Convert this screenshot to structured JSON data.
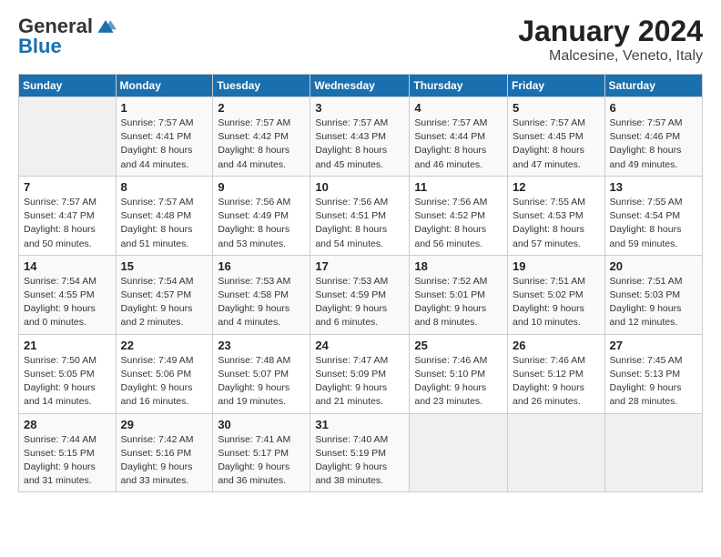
{
  "logo": {
    "general": "General",
    "blue": "Blue"
  },
  "title": {
    "month": "January 2024",
    "location": "Malcesine, Veneto, Italy"
  },
  "weekdays": [
    "Sunday",
    "Monday",
    "Tuesday",
    "Wednesday",
    "Thursday",
    "Friday",
    "Saturday"
  ],
  "weeks": [
    [
      {
        "day": "",
        "info": ""
      },
      {
        "day": "1",
        "info": "Sunrise: 7:57 AM\nSunset: 4:41 PM\nDaylight: 8 hours\nand 44 minutes."
      },
      {
        "day": "2",
        "info": "Sunrise: 7:57 AM\nSunset: 4:42 PM\nDaylight: 8 hours\nand 44 minutes."
      },
      {
        "day": "3",
        "info": "Sunrise: 7:57 AM\nSunset: 4:43 PM\nDaylight: 8 hours\nand 45 minutes."
      },
      {
        "day": "4",
        "info": "Sunrise: 7:57 AM\nSunset: 4:44 PM\nDaylight: 8 hours\nand 46 minutes."
      },
      {
        "day": "5",
        "info": "Sunrise: 7:57 AM\nSunset: 4:45 PM\nDaylight: 8 hours\nand 47 minutes."
      },
      {
        "day": "6",
        "info": "Sunrise: 7:57 AM\nSunset: 4:46 PM\nDaylight: 8 hours\nand 49 minutes."
      }
    ],
    [
      {
        "day": "7",
        "info": "Sunrise: 7:57 AM\nSunset: 4:47 PM\nDaylight: 8 hours\nand 50 minutes."
      },
      {
        "day": "8",
        "info": "Sunrise: 7:57 AM\nSunset: 4:48 PM\nDaylight: 8 hours\nand 51 minutes."
      },
      {
        "day": "9",
        "info": "Sunrise: 7:56 AM\nSunset: 4:49 PM\nDaylight: 8 hours\nand 53 minutes."
      },
      {
        "day": "10",
        "info": "Sunrise: 7:56 AM\nSunset: 4:51 PM\nDaylight: 8 hours\nand 54 minutes."
      },
      {
        "day": "11",
        "info": "Sunrise: 7:56 AM\nSunset: 4:52 PM\nDaylight: 8 hours\nand 56 minutes."
      },
      {
        "day": "12",
        "info": "Sunrise: 7:55 AM\nSunset: 4:53 PM\nDaylight: 8 hours\nand 57 minutes."
      },
      {
        "day": "13",
        "info": "Sunrise: 7:55 AM\nSunset: 4:54 PM\nDaylight: 8 hours\nand 59 minutes."
      }
    ],
    [
      {
        "day": "14",
        "info": "Sunrise: 7:54 AM\nSunset: 4:55 PM\nDaylight: 9 hours\nand 0 minutes."
      },
      {
        "day": "15",
        "info": "Sunrise: 7:54 AM\nSunset: 4:57 PM\nDaylight: 9 hours\nand 2 minutes."
      },
      {
        "day": "16",
        "info": "Sunrise: 7:53 AM\nSunset: 4:58 PM\nDaylight: 9 hours\nand 4 minutes."
      },
      {
        "day": "17",
        "info": "Sunrise: 7:53 AM\nSunset: 4:59 PM\nDaylight: 9 hours\nand 6 minutes."
      },
      {
        "day": "18",
        "info": "Sunrise: 7:52 AM\nSunset: 5:01 PM\nDaylight: 9 hours\nand 8 minutes."
      },
      {
        "day": "19",
        "info": "Sunrise: 7:51 AM\nSunset: 5:02 PM\nDaylight: 9 hours\nand 10 minutes."
      },
      {
        "day": "20",
        "info": "Sunrise: 7:51 AM\nSunset: 5:03 PM\nDaylight: 9 hours\nand 12 minutes."
      }
    ],
    [
      {
        "day": "21",
        "info": "Sunrise: 7:50 AM\nSunset: 5:05 PM\nDaylight: 9 hours\nand 14 minutes."
      },
      {
        "day": "22",
        "info": "Sunrise: 7:49 AM\nSunset: 5:06 PM\nDaylight: 9 hours\nand 16 minutes."
      },
      {
        "day": "23",
        "info": "Sunrise: 7:48 AM\nSunset: 5:07 PM\nDaylight: 9 hours\nand 19 minutes."
      },
      {
        "day": "24",
        "info": "Sunrise: 7:47 AM\nSunset: 5:09 PM\nDaylight: 9 hours\nand 21 minutes."
      },
      {
        "day": "25",
        "info": "Sunrise: 7:46 AM\nSunset: 5:10 PM\nDaylight: 9 hours\nand 23 minutes."
      },
      {
        "day": "26",
        "info": "Sunrise: 7:46 AM\nSunset: 5:12 PM\nDaylight: 9 hours\nand 26 minutes."
      },
      {
        "day": "27",
        "info": "Sunrise: 7:45 AM\nSunset: 5:13 PM\nDaylight: 9 hours\nand 28 minutes."
      }
    ],
    [
      {
        "day": "28",
        "info": "Sunrise: 7:44 AM\nSunset: 5:15 PM\nDaylight: 9 hours\nand 31 minutes."
      },
      {
        "day": "29",
        "info": "Sunrise: 7:42 AM\nSunset: 5:16 PM\nDaylight: 9 hours\nand 33 minutes."
      },
      {
        "day": "30",
        "info": "Sunrise: 7:41 AM\nSunset: 5:17 PM\nDaylight: 9 hours\nand 36 minutes."
      },
      {
        "day": "31",
        "info": "Sunrise: 7:40 AM\nSunset: 5:19 PM\nDaylight: 9 hours\nand 38 minutes."
      },
      {
        "day": "",
        "info": ""
      },
      {
        "day": "",
        "info": ""
      },
      {
        "day": "",
        "info": ""
      }
    ]
  ]
}
